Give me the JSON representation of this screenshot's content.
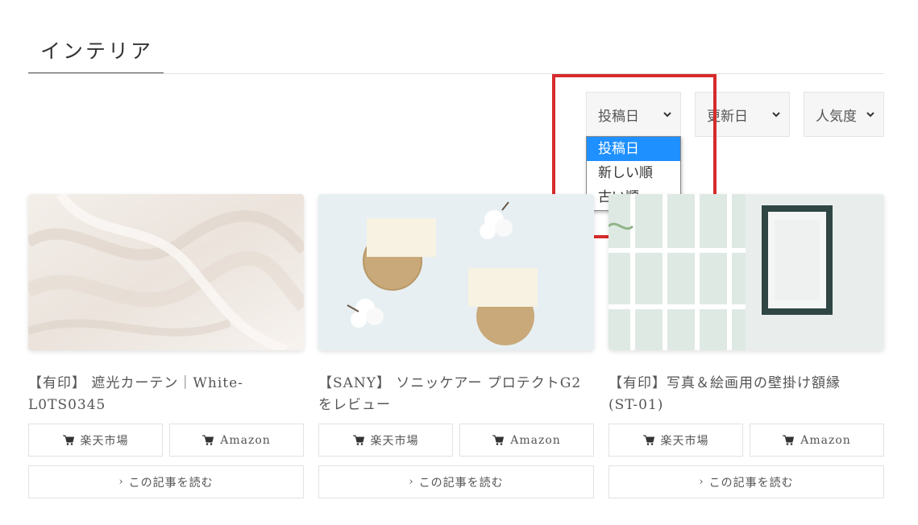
{
  "page": {
    "title": "インテリア"
  },
  "sort": {
    "posted_label": "投稿日",
    "updated_label": "更新日",
    "popular_label": "人気度",
    "dropdown_options": [
      "投稿日",
      "新しい順",
      "古い順"
    ]
  },
  "cards": [
    {
      "title_line1": "【有印】 遮光カーテン｜White-",
      "title_line2": "L0TS0345",
      "rakuten_label": "楽天市場",
      "amazon_label": "Amazon",
      "read_label": "この記事を読む",
      "thumb_icon": "silk-fabric-image"
    },
    {
      "title_line1": "【SANY】 ソニッケアー プロテクトG2",
      "title_line2": "をレビュー",
      "rakuten_label": "楽天市場",
      "amazon_label": "Amazon",
      "read_label": "この記事を読む",
      "thumb_icon": "cards-and-cotton-image"
    },
    {
      "title_line1": "【有印】写真＆絵画用の壁掛け額縁",
      "title_line2": "(ST-01)",
      "rakuten_label": "楽天市場",
      "amazon_label": "Amazon",
      "read_label": "この記事を読む",
      "thumb_icon": "window-and-frame-image"
    }
  ],
  "colors": {
    "highlight": "#d62b2b",
    "selected_option": "#1e90ff"
  }
}
